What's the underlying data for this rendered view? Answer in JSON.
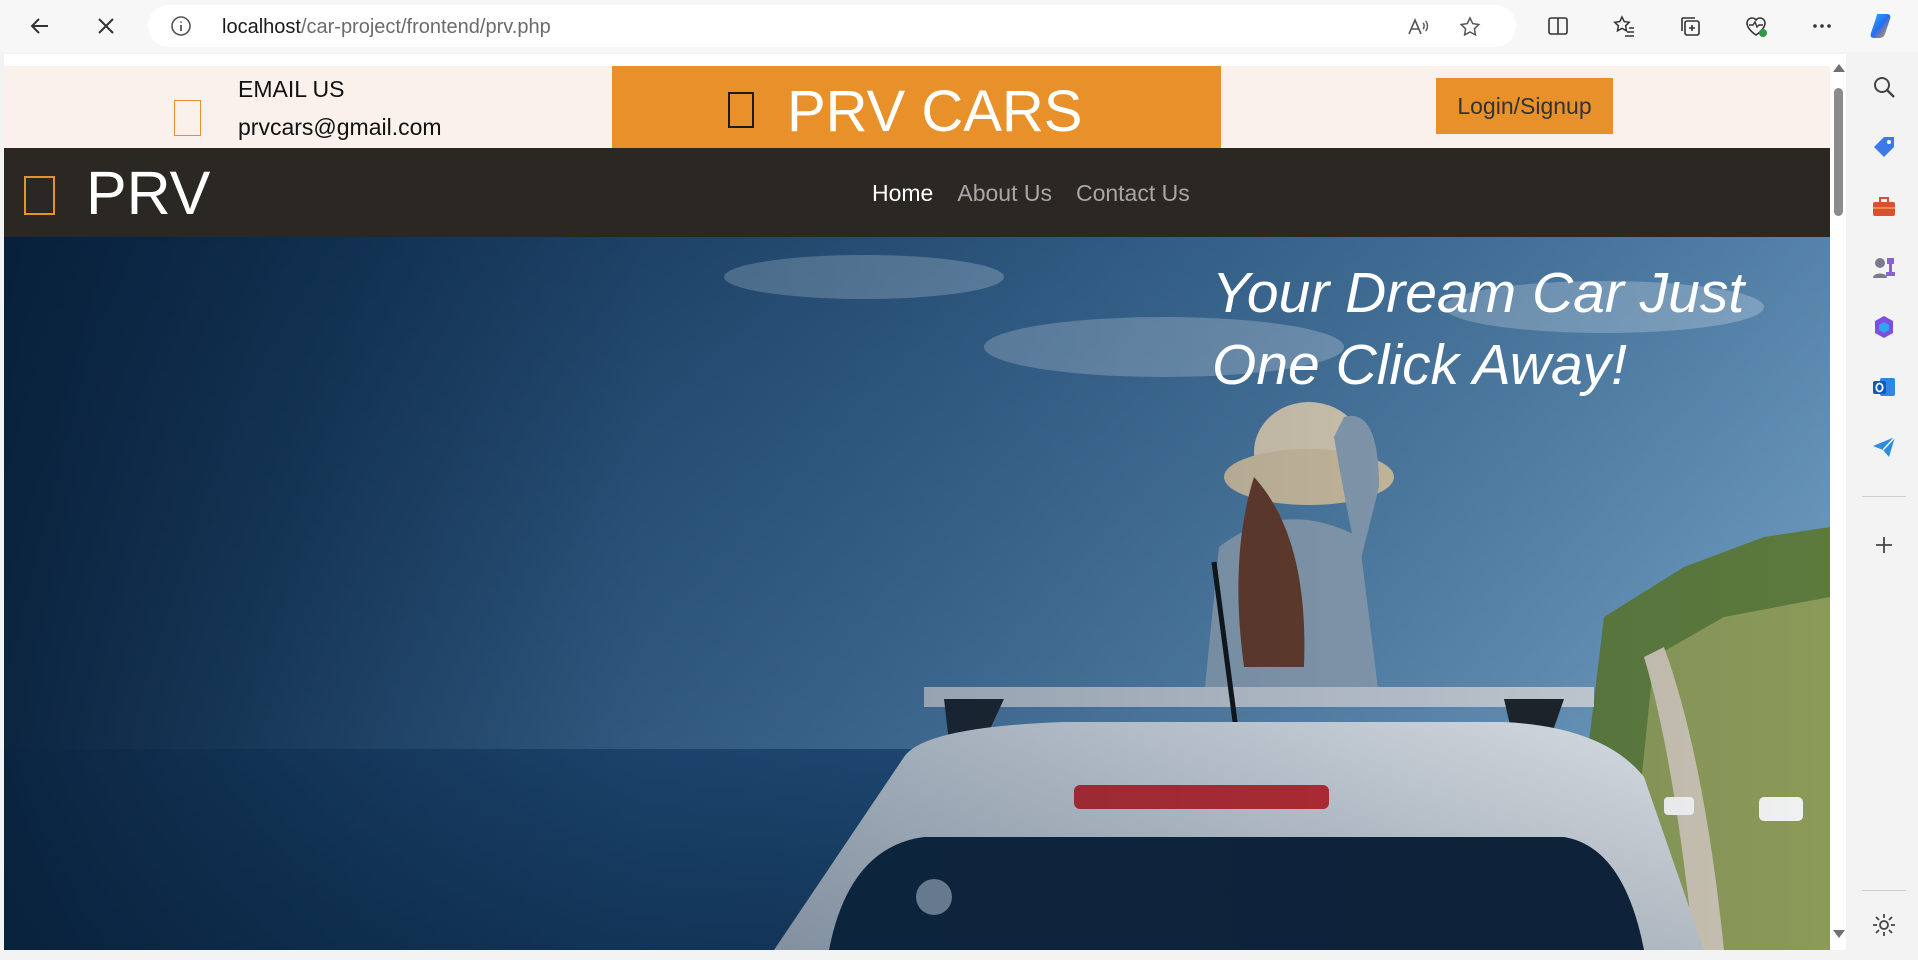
{
  "browser": {
    "url_host": "localhost",
    "url_path": "/car-project/frontend/prv.php"
  },
  "topbar": {
    "email_label": "EMAIL US",
    "email_value": "prvcars@gmail.com",
    "brand": "PRV CARS",
    "login_label": "Login/Signup"
  },
  "navbar": {
    "logo": "PRV",
    "links": [
      {
        "label": "Home",
        "active": true
      },
      {
        "label": "About Us",
        "active": false
      },
      {
        "label": "Contact Us",
        "active": false
      }
    ]
  },
  "hero": {
    "headline": "Your Dream Car Just One Click Away!"
  },
  "colors": {
    "accent": "#e8902a",
    "topbar_bg": "#fbf1ec",
    "navbar_bg": "#2b2723"
  }
}
